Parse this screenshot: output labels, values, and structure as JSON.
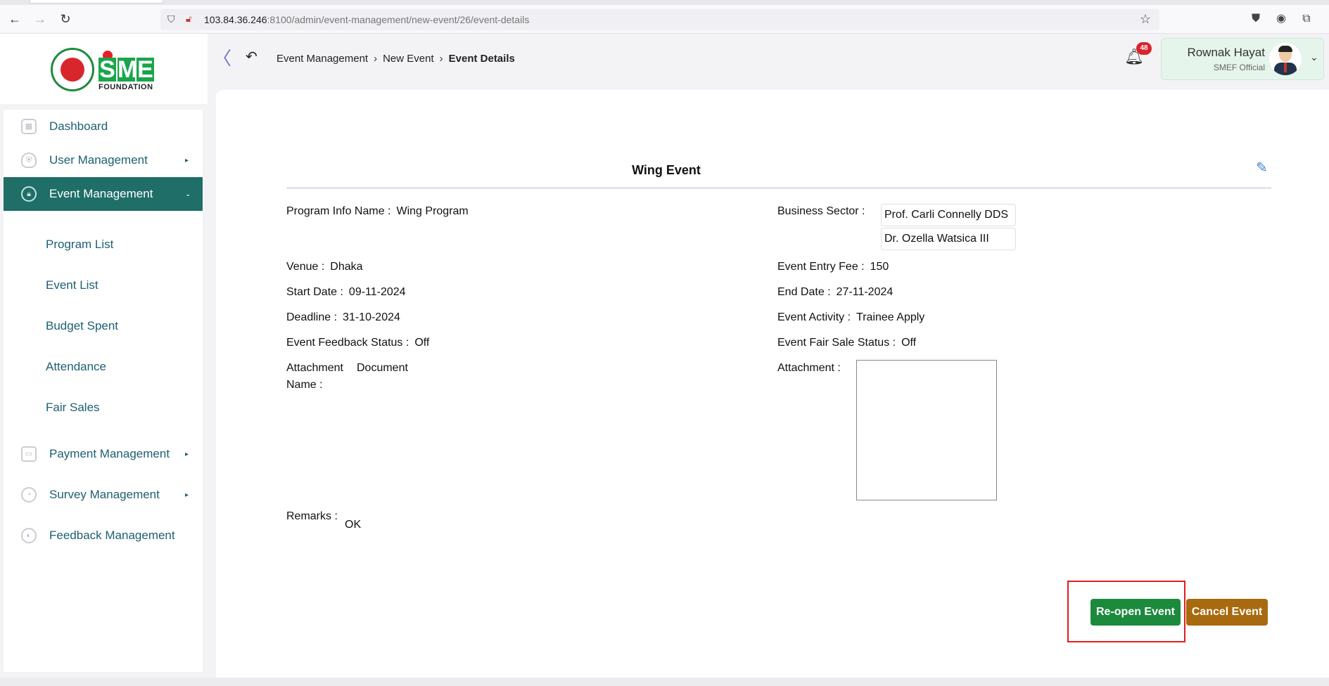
{
  "browser": {
    "url_host": "103.84.36.246",
    "url_path": ":8100/admin/event-management/new-event/26/event-details"
  },
  "brand": {
    "logo_letters": [
      "S",
      "M",
      "E"
    ],
    "logo_subtitle": "FOUNDATION"
  },
  "sidebar": {
    "items": [
      {
        "label": "Dashboard",
        "has_caret": false
      },
      {
        "label": "User Management",
        "caret": "▸"
      },
      {
        "label": "Event Management",
        "caret": "⌄"
      },
      {
        "label": "Payment Management",
        "caret": "▸"
      },
      {
        "label": "Survey Management",
        "caret": "▸"
      },
      {
        "label": "Feedback Management",
        "has_caret": false
      }
    ],
    "sub_items": [
      "Program List",
      "Event List",
      "Budget Spent",
      "Attendance",
      "Fair Sales"
    ]
  },
  "header": {
    "breadcrumb": [
      "Event Management",
      "New Event",
      "Event Details"
    ],
    "notification_count": "48",
    "user_name": "Rownak Hayat",
    "user_role": "SMEF Official"
  },
  "event": {
    "title": "Wing Event",
    "program_info_name_label": "Program Info Name :",
    "program_info_name": "Wing Program",
    "business_sector_label": "Business Sector :",
    "business_sectors": [
      "Prof. Carli Connelly DDS",
      "Dr. Ozella Watsica III"
    ],
    "venue_label": "Venue :",
    "venue": "Dhaka",
    "entry_fee_label": "Event Entry Fee :",
    "entry_fee": "150",
    "start_date_label": "Start Date :",
    "start_date": "09-11-2024",
    "end_date_label": "End Date :",
    "end_date": "27-11-2024",
    "deadline_label": "Deadline :",
    "deadline": "31-10-2024",
    "activity_label": "Event Activity :",
    "activity": "Trainee Apply",
    "feedback_status_label": "Event Feedback Status :",
    "feedback_status": "Off",
    "fair_sale_status_label": "Event Fair Sale Status :",
    "fair_sale_status": "Off",
    "attachment_name_label_1": "Attachment",
    "attachment_name_label_2": "Name :",
    "attachment_name": "Document",
    "attachment_label": "Attachment :",
    "remarks_label": "Remarks :",
    "remarks": "OK"
  },
  "actions": {
    "reopen_label": "Re-open Event",
    "cancel_label": "Cancel Event"
  },
  "colors": {
    "primary": "#1f6e68",
    "reopen": "#1b8a3c",
    "cancel": "#a86a0e",
    "highlight": "#e11d1d"
  }
}
